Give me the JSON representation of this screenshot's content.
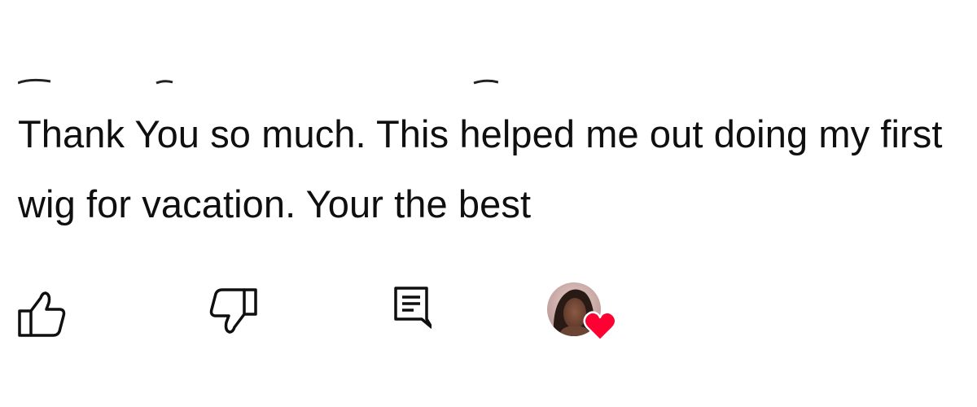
{
  "comment": {
    "text": "Thank You so much. This helped me out doing my first wig for vacation. Your the best"
  },
  "actions": {
    "like_icon": "thumbs-up-icon",
    "dislike_icon": "thumbs-down-icon",
    "reply_icon": "comment-reply-icon",
    "creator_heart_icon": "heart-icon"
  },
  "colors": {
    "text": "#0f0f0f",
    "heart": "#ff0033",
    "background": "#ffffff"
  }
}
